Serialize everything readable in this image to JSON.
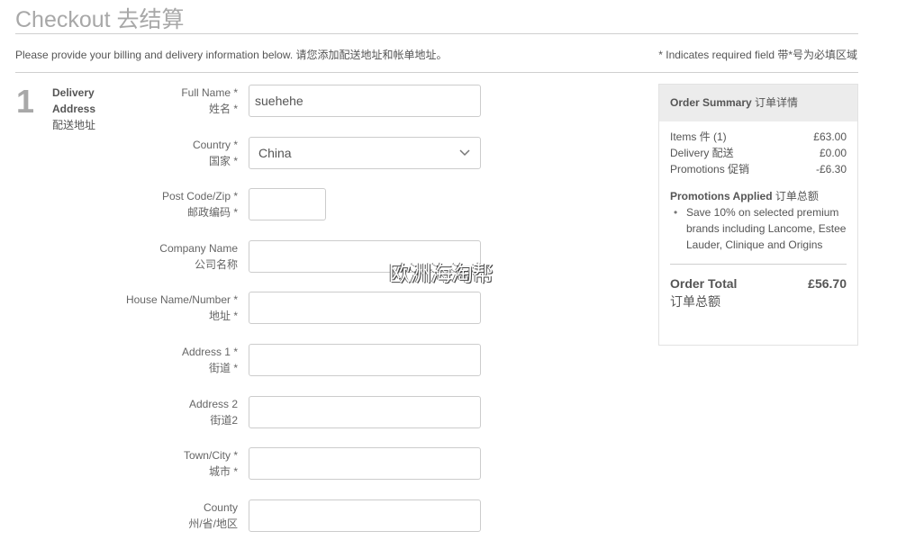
{
  "page": {
    "title": "Checkout 去结算",
    "intro": "Please provide your billing and delivery information below. 请您添加配送地址和帐单地址。",
    "required_note": "* Indicates required field 带*号为必填区域"
  },
  "step": {
    "number": "1",
    "label_en_1": "Delivery",
    "label_en_2": "Address",
    "label_cn": "配送地址"
  },
  "form": {
    "fields": [
      {
        "label_en": "Full Name *",
        "label_cn": "姓名 *",
        "value": "suehehe",
        "type": "text"
      },
      {
        "label_en": "Country *",
        "label_cn": "国家 *",
        "value": "China",
        "type": "select"
      },
      {
        "label_en": "Post Code/Zip *",
        "label_cn": "邮政编码 *",
        "value": "",
        "type": "text"
      },
      {
        "label_en": "Company Name",
        "label_cn": "公司名称",
        "value": "",
        "type": "text"
      },
      {
        "label_en": "House Name/Number *",
        "label_cn": "地址 *",
        "value": "",
        "type": "text"
      },
      {
        "label_en": "Address 1 *",
        "label_cn": "街道 *",
        "value": "",
        "type": "text"
      },
      {
        "label_en": "Address 2",
        "label_cn": "街道2",
        "value": "",
        "type": "text"
      },
      {
        "label_en": "Town/City *",
        "label_cn": "城市 *",
        "value": "",
        "type": "text"
      },
      {
        "label_en": "County",
        "label_cn": "州/省/地区",
        "value": "",
        "type": "text"
      }
    ]
  },
  "summary": {
    "title_en": "Order Summary",
    "title_cn": "订单详情",
    "items_label": "Items 件 (1)",
    "items_value": "£63.00",
    "delivery_label": "Delivery 配送",
    "delivery_value": "£0.00",
    "promotions_label": "Promotions 促销",
    "promotions_value": "-£6.30",
    "promos_applied_en": "Promotions Applied",
    "promos_applied_cn": "订单总额",
    "promos": [
      "Save 10% on selected premium brands including Lancome, Estee Lauder, Clinique and Origins"
    ],
    "total_label": "Order Total",
    "total_value": "£56.70",
    "total_cn": "订单总额"
  },
  "watermark": "欧洲海淘帮"
}
